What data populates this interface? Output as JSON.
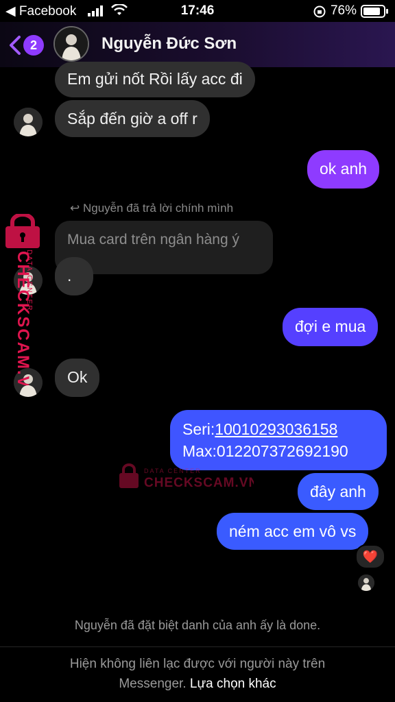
{
  "status_bar": {
    "back_app": "◀ Facebook",
    "time": "17:46",
    "battery_percent": "76%"
  },
  "header": {
    "unread_count": "2",
    "contact_name": "Nguyễn Đức Sơn"
  },
  "messages": {
    "m1": "Em gửi nốt Rồi lấy acc đi",
    "m2": "Sắp đến giờ a off r",
    "m3": "ok anh",
    "reply_note": "Nguyễn đã trả lời chính mình",
    "quoted": "Mua card trên ngân hàng ý",
    "m4": ".",
    "m5": "đợi e mua",
    "m6": "Ok",
    "m7_line1_label": "Seri:",
    "m7_line1_value": "10010293036158",
    "m7_line2": "Max:012207372692190",
    "m8": "đây anh",
    "m9": "ném acc em vô vs"
  },
  "reaction": "❤️",
  "system_note": "Nguyễn đã đặt biệt danh của anh ấy là done.",
  "footer": {
    "line1": "Hiện không liên lạc được với người này trên",
    "line2": "Messenger.",
    "link": "Lựa chọn khác"
  },
  "watermark": {
    "brand": "CHECKSCAM.VN",
    "sub": "DATA CENTER"
  },
  "colors": {
    "bubble_in": "#303030",
    "bubble_out_purple": "#8e3bff",
    "bubble_out_blue": "#3a5bff",
    "background": "#000000"
  }
}
